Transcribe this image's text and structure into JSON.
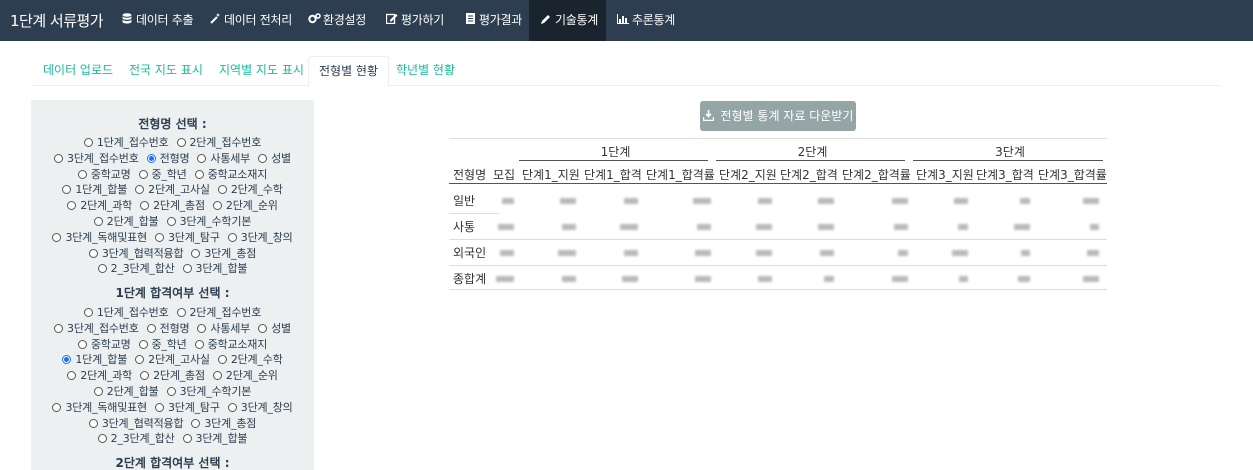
{
  "navbar": {
    "brand": "1단계 서류평가",
    "items": [
      {
        "icon": "database-icon",
        "label": "데이터 추출"
      },
      {
        "icon": "magic-wand-icon",
        "label": "데이터 전처리"
      },
      {
        "icon": "cogs-icon",
        "label": "환경설정"
      },
      {
        "icon": "edit-icon",
        "label": "평가하기"
      },
      {
        "icon": "file-text-icon",
        "label": "평가결과"
      },
      {
        "icon": "pencil-icon",
        "label": "기술통계"
      },
      {
        "icon": "bar-chart-icon",
        "label": "추론통계"
      }
    ],
    "active_index": 5
  },
  "tabs": {
    "items": [
      "데이터 업로드",
      "전국 지도 표시",
      "지역별 지도 표시",
      "전형별 현황",
      "학년별 현황"
    ],
    "active_index": 3
  },
  "sidebar": {
    "groups": [
      {
        "label": "전형명 선택 :",
        "options": [
          [
            "1단계_접수번호",
            "2단계_접수번호"
          ],
          [
            "3단계_접수번호",
            "전형명",
            "사통세부",
            "성별"
          ],
          [
            "중학교명",
            "중_학년",
            "중학교소재지"
          ],
          [
            "1단계_합불",
            "2단계_고사실",
            "2단계_수학"
          ],
          [
            "2단계_과학",
            "2단계_총점",
            "2단계_순위"
          ],
          [
            "2단계_합불",
            "3단계_수학기본"
          ],
          [
            "3단계_독해및표현",
            "3단계_탐구",
            "3단계_창의"
          ],
          [
            "3단계_협력적융합",
            "3단계_총점"
          ],
          [
            "2_3단계_합산",
            "3단계_합불"
          ]
        ],
        "selected": "전형명"
      },
      {
        "label": "1단계 합격여부 선택 :",
        "options": [
          [
            "1단계_접수번호",
            "2단계_접수번호"
          ],
          [
            "3단계_접수번호",
            "전형명",
            "사통세부",
            "성별"
          ],
          [
            "중학교명",
            "중_학년",
            "중학교소재지"
          ],
          [
            "1단계_합불",
            "2단계_고사실",
            "2단계_수학"
          ],
          [
            "2단계_과학",
            "2단계_총점",
            "2단계_순위"
          ],
          [
            "2단계_합불",
            "3단계_수학기본"
          ],
          [
            "3단계_독해및표현",
            "3단계_탐구",
            "3단계_창의"
          ],
          [
            "3단계_협력적융합",
            "3단계_총점"
          ],
          [
            "2_3단계_합산",
            "3단계_합불"
          ]
        ],
        "selected": "1단계_합불"
      },
      {
        "label": "2단계 합격여부 선택 :"
      }
    ]
  },
  "download_button": {
    "icon": "download-icon",
    "label": "전형별 통계 자료 다운받기"
  },
  "table": {
    "group_headers": [
      "1단계",
      "2단계",
      "3단계"
    ],
    "columns": [
      "전형명",
      "모집",
      "단계1_지원",
      "단계1_합격",
      "단계1_합격률",
      "단계2_지원",
      "단계2_합격",
      "단계2_합격률",
      "단계3_지원",
      "단계3_합격",
      "단계3_합격률"
    ],
    "rows": [
      "일반",
      "사통",
      "외국인",
      "종합계"
    ]
  }
}
